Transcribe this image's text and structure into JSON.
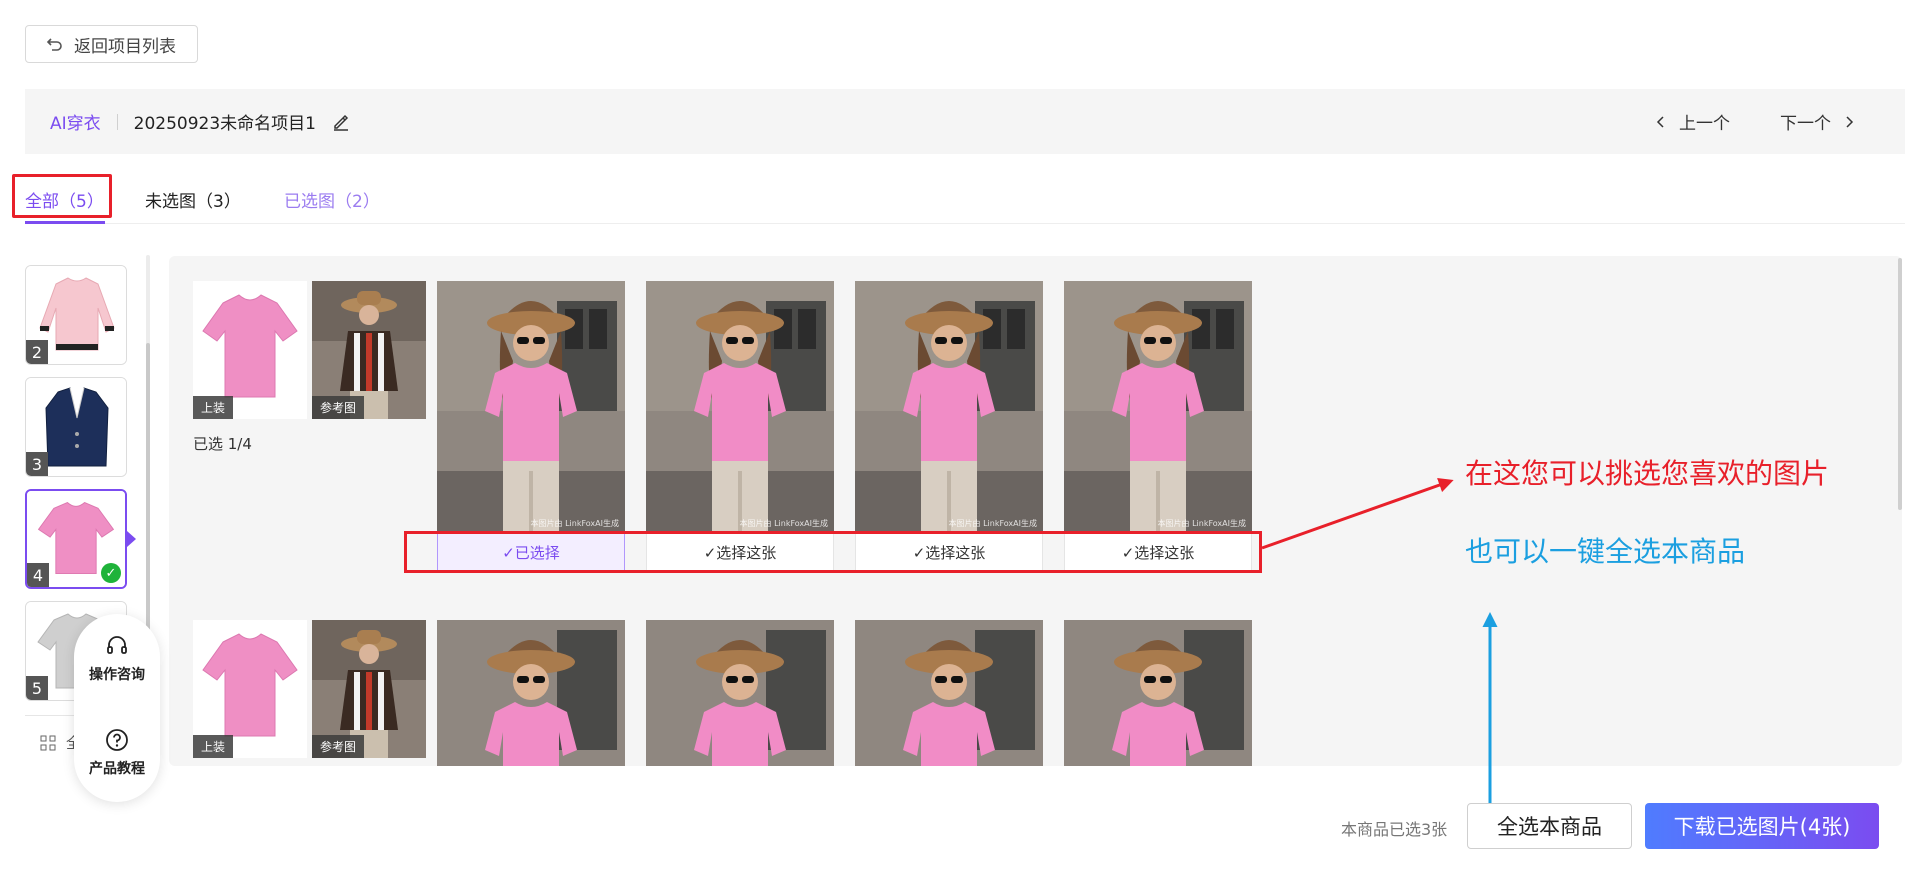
{
  "back_button": {
    "label": "返回项目列表"
  },
  "topbar": {
    "breadcrumb": "AI穿衣",
    "project_name": "20250923未命名项目1",
    "prev_label": "上一个",
    "next_label": "下一个"
  },
  "tabs": [
    {
      "label": "全部（5）"
    },
    {
      "label": "未选图（3）"
    },
    {
      "label": "已选图（2）"
    }
  ],
  "thumbnails": [
    {
      "number": "2",
      "garment": "pink sweater"
    },
    {
      "number": "3",
      "garment": "navy blazer"
    },
    {
      "number": "4",
      "garment": "pink t-shirt",
      "selected": true
    },
    {
      "number": "5",
      "garment": "grey t-shirt"
    }
  ],
  "grid_toggle_label": "全",
  "float_help": {
    "consult_label": "操作咨询",
    "tutorial_label": "产品教程"
  },
  "rows": [
    {
      "garment_tag": "上装",
      "reference_tag": "参考图",
      "selected_count": "已选 1/4",
      "results": [
        {
          "button": "✓已选择",
          "selected": true,
          "watermark": "本图片由 LinkFoxAI生成"
        },
        {
          "button": "✓选择这张",
          "selected": false,
          "watermark": "本图片由 LinkFoxAI生成"
        },
        {
          "button": "✓选择这张",
          "selected": false,
          "watermark": "本图片由 LinkFoxAI生成"
        },
        {
          "button": "✓选择这张",
          "selected": false,
          "watermark": "本图片由 LinkFoxAI生成"
        }
      ]
    },
    {
      "garment_tag": "上装",
      "reference_tag": "参考图"
    }
  ],
  "annotations": {
    "red_text": "在这您可以挑选您喜欢的图片",
    "blue_text": "也可以一键全选本商品"
  },
  "footer": {
    "count_text": "本商品已选3张",
    "select_all_label": "全选本商品",
    "download_label": "下载已选图片(4张)"
  },
  "colors": {
    "accent": "#7b4cf0",
    "annotation_red": "#e8202a",
    "annotation_blue": "#1b9fe0",
    "success": "#1fb33a"
  }
}
